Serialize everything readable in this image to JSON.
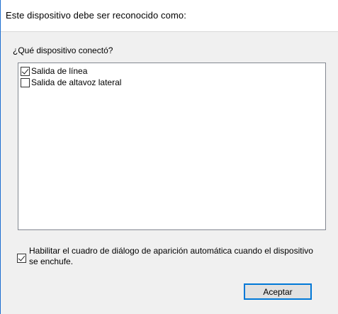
{
  "header": {
    "title": "Este dispositivo debe ser reconocido como:"
  },
  "device_question": {
    "label": "¿Qué dispositivo conectó?"
  },
  "device_list": {
    "items": [
      {
        "label": "Salida de línea",
        "checked": true
      },
      {
        "label": "Salida de altavoz lateral",
        "checked": false
      }
    ]
  },
  "auto_popup": {
    "label": "Habilitar el cuadro de diálogo de aparición automática cuando el dispositivo se enchufe.",
    "checked": true
  },
  "buttons": {
    "ok_label": "Aceptar"
  },
  "colors": {
    "accent_border": "#0078d7",
    "panel_background": "#f0f0f0",
    "window_edge": "#1e6fd0"
  }
}
